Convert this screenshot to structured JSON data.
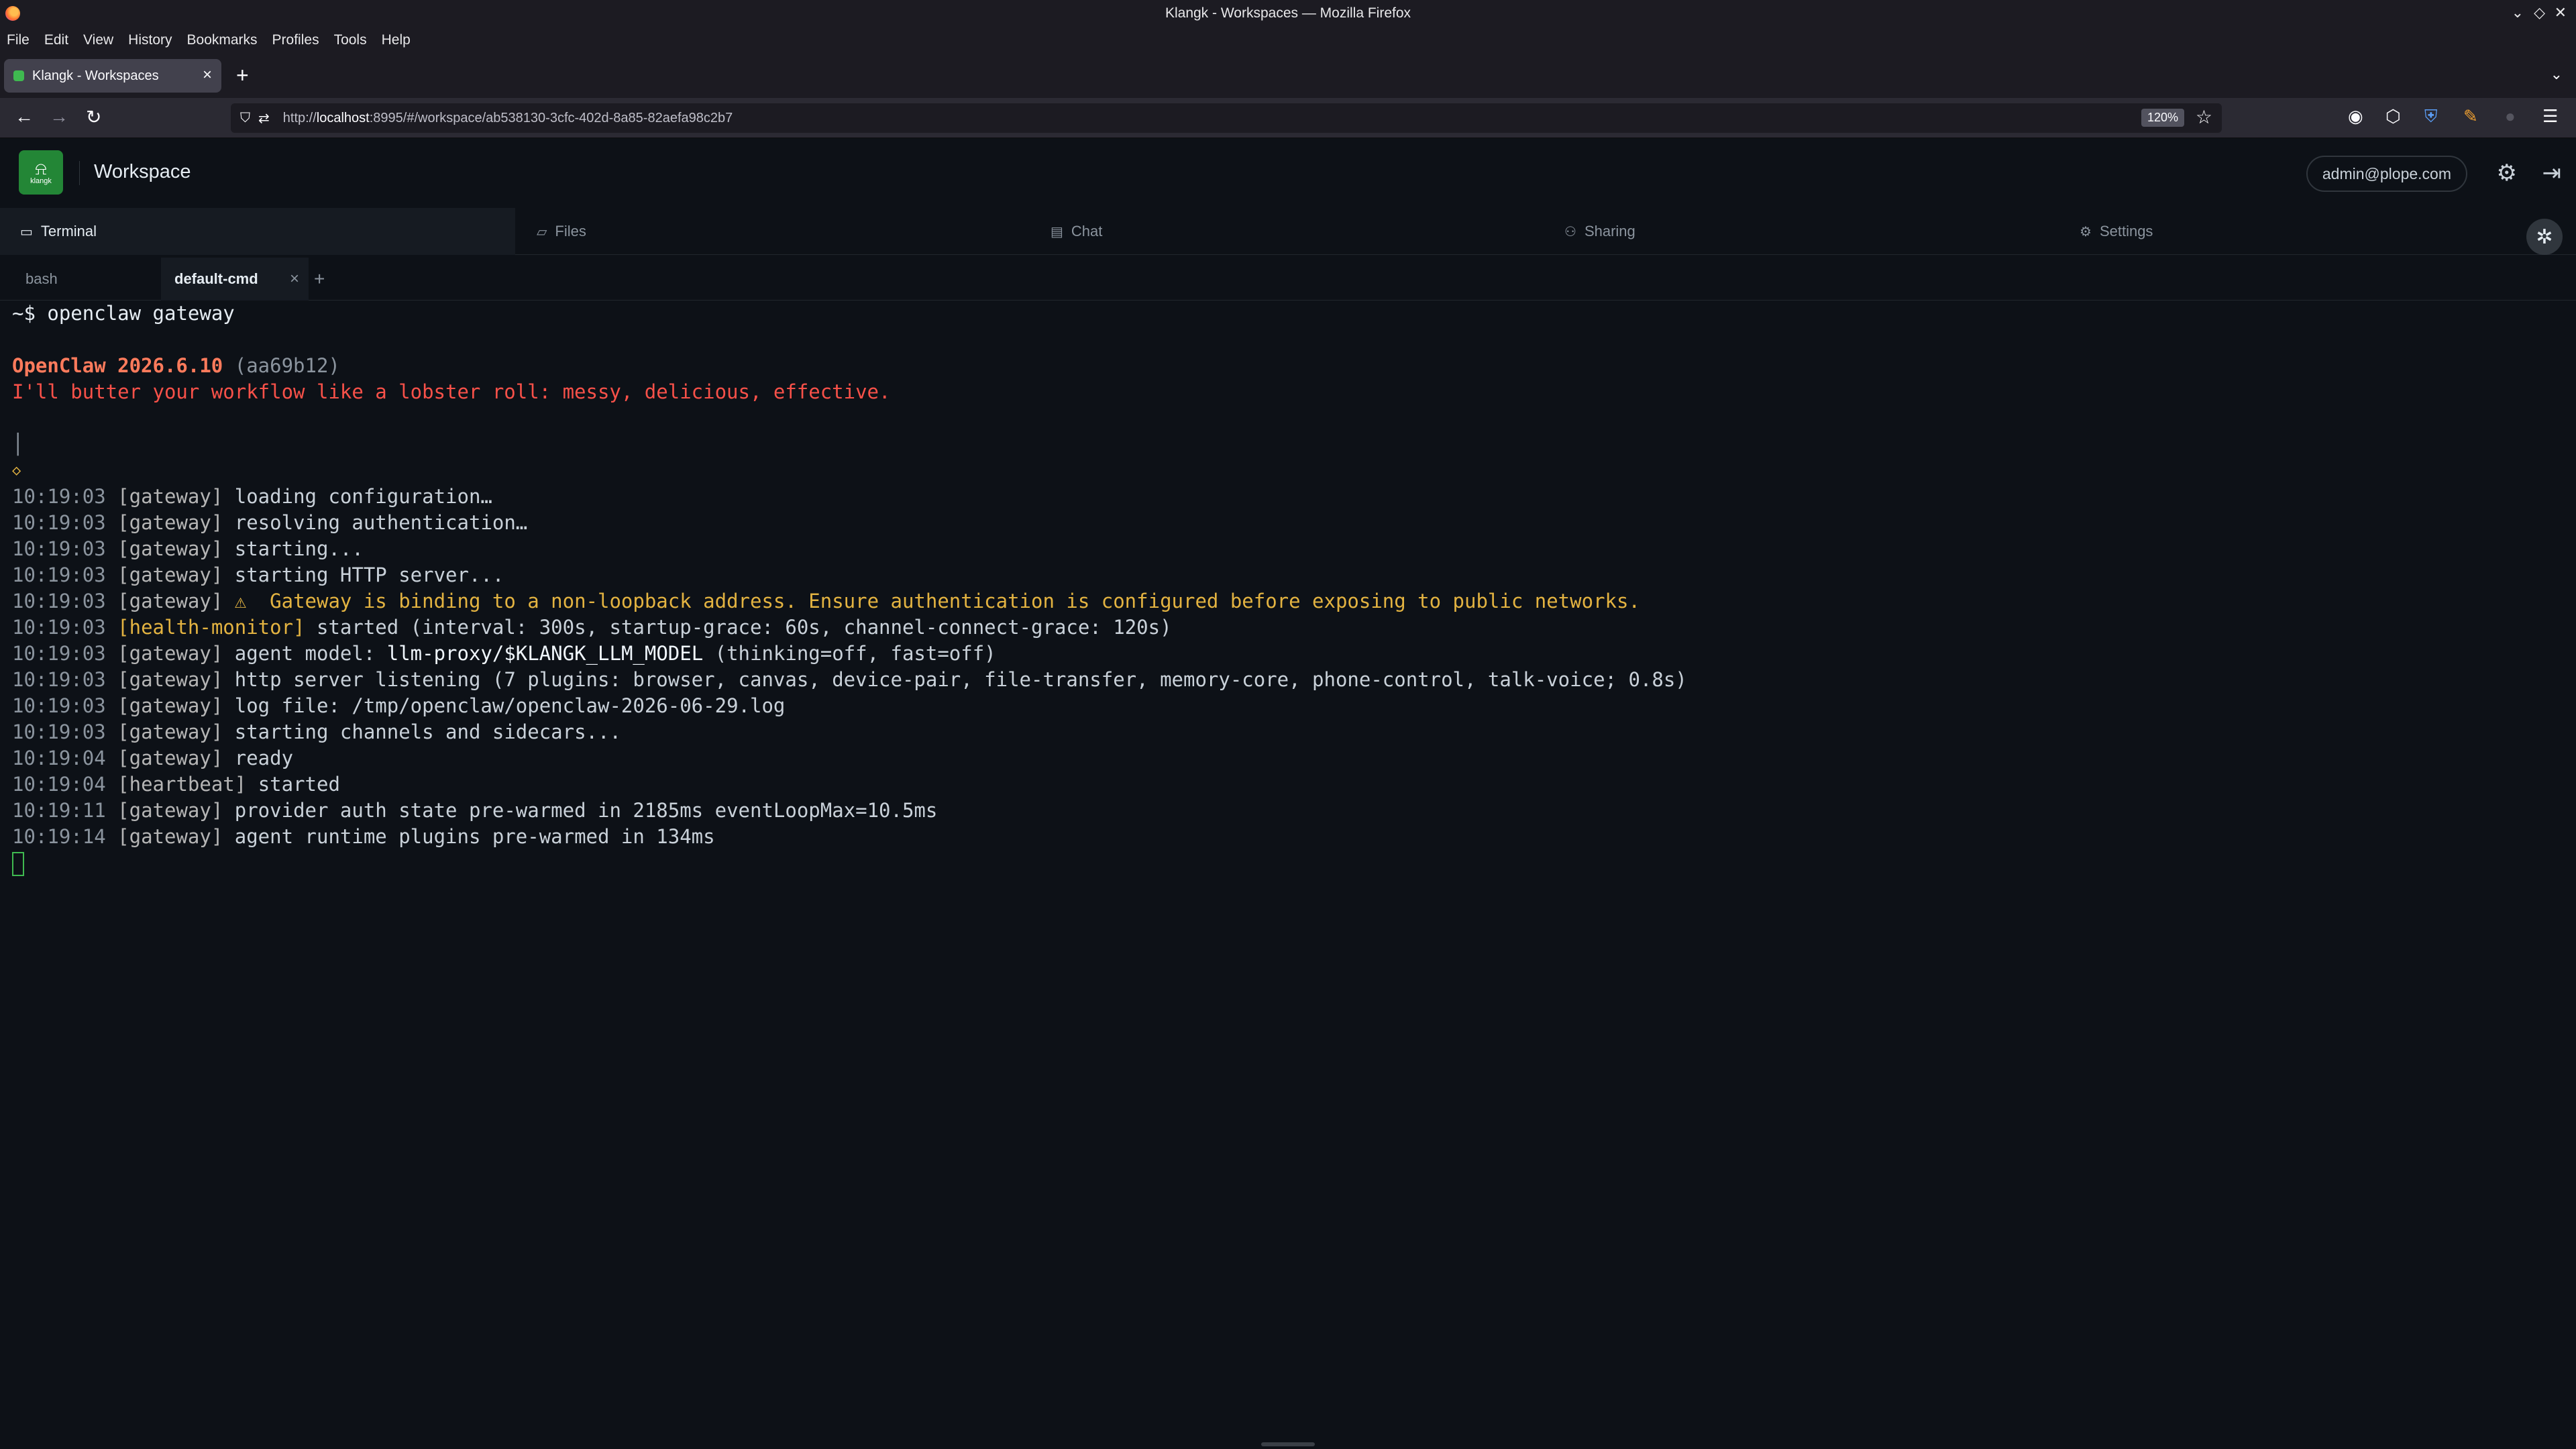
{
  "window": {
    "title": "Klangk - Workspaces — Mozilla Firefox",
    "controls": [
      "⌄",
      "◇",
      "✕"
    ]
  },
  "menubar": [
    "File",
    "Edit",
    "View",
    "History",
    "Bookmarks",
    "Profiles",
    "Tools",
    "Help"
  ],
  "browser_tab": {
    "label": "Klangk - Workspaces"
  },
  "navbar": {
    "url_prefix": "http://",
    "url_host": "localhost",
    "url_rest": ":8995/#/workspace/ab538130-3cfc-402d-8a85-82aefa98c2b7",
    "zoom": "120%"
  },
  "app": {
    "logo_text": "klangk",
    "title": "Workspace",
    "user": "admin@plope.com"
  },
  "nav_tabs": [
    {
      "label": "Terminal",
      "icon": "terminal-icon",
      "glyph": "▭"
    },
    {
      "label": "Files",
      "icon": "folder-icon",
      "glyph": "▱"
    },
    {
      "label": "Chat",
      "icon": "chat-icon",
      "glyph": "▤"
    },
    {
      "label": "Sharing",
      "icon": "users-icon",
      "glyph": "⚇"
    },
    {
      "label": "Settings",
      "icon": "gear-icon",
      "glyph": "⚙"
    }
  ],
  "term_tabs": [
    {
      "label": "bash"
    },
    {
      "label": "default-cmd"
    }
  ],
  "terminal": {
    "command_prompt": "~$",
    "command": "openclaw gateway",
    "banner_name": "OpenClaw 2026.6.10",
    "banner_hash": "(aa69b12)",
    "tagline": "I'll butter your workflow like a lobster roll: messy, delicious, effective.",
    "bar": "│",
    "diamond": "◇",
    "lines": [
      {
        "time": "10:19:03",
        "tag": "[gateway]",
        "msg": "loading configuration…"
      },
      {
        "time": "10:19:03",
        "tag": "[gateway]",
        "msg": "resolving authentication…"
      },
      {
        "time": "10:19:03",
        "tag": "[gateway]",
        "msg": "starting..."
      },
      {
        "time": "10:19:03",
        "tag": "[gateway]",
        "msg": "starting HTTP server..."
      },
      {
        "time": "10:19:03",
        "tag": "[gateway]",
        "warn": "⚠  Gateway is binding to a non-loopback address. Ensure authentication is configured before exposing to public networks."
      },
      {
        "time": "10:19:03",
        "tag": "[health-monitor]",
        "msg": "started (interval: 300s, startup-grace: 60s, channel-connect-grace: 120s)"
      },
      {
        "time": "10:19:03",
        "tag": "[gateway]",
        "msg": "agent model: ",
        "highlight": "llm-proxy/$KLANGK_LLM_MODEL",
        "after": " (thinking=off, fast=off)"
      },
      {
        "time": "10:19:03",
        "tag": "[gateway]",
        "msg": "http server listening (7 plugins: browser, canvas, device-pair, file-transfer, memory-core, phone-control, talk-voice; 0.8s)"
      },
      {
        "time": "10:19:03",
        "tag": "[gateway]",
        "msg": "log file: /tmp/openclaw/openclaw-2026-06-29.log"
      },
      {
        "time": "10:19:03",
        "tag": "[gateway]",
        "msg": "starting channels and sidecars..."
      },
      {
        "time": "10:19:04",
        "tag": "[gateway]",
        "msg": "ready"
      },
      {
        "time": "10:19:04",
        "tag": "[heartbeat]",
        "msg": "started"
      },
      {
        "time": "10:19:11",
        "tag": "[gateway]",
        "msg": "provider auth state pre-warmed in 2185ms eventLoopMax=10.5ms"
      },
      {
        "time": "10:19:14",
        "tag": "[gateway]",
        "msg": "agent runtime plugins pre-warmed in 134ms"
      }
    ]
  }
}
